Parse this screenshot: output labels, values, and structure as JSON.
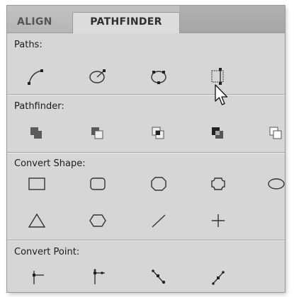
{
  "tabs": [
    {
      "label": "ALIGN",
      "active": false
    },
    {
      "label": "PATHFINDER",
      "active": true
    }
  ],
  "sections": {
    "paths": {
      "label": "Paths:",
      "icons": [
        "open-path",
        "close-path",
        "reverse-path",
        "join-path"
      ]
    },
    "pathfinder": {
      "label": "Pathfinder:",
      "icons": [
        "unite",
        "minus-front",
        "intersect",
        "exclude",
        "divide"
      ]
    },
    "convert_shape": {
      "label": "Convert Shape:",
      "icons": [
        "rectangle",
        "rounded-rectangle",
        "beveled-rectangle",
        "inverse-rounded-rectangle",
        "ellipse",
        "triangle",
        "polygon",
        "line",
        "orthogonal-line"
      ]
    },
    "convert_point": {
      "label": "Convert Point:",
      "icons": [
        "plain-point",
        "corner-point",
        "smooth-point",
        "symmetrical-point"
      ]
    }
  }
}
